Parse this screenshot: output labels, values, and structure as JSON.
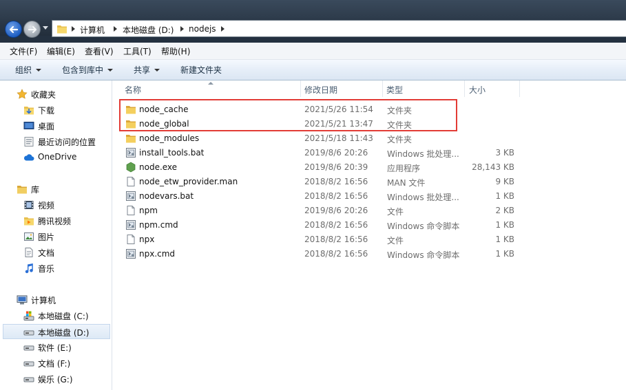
{
  "address": {
    "breadcrumbs": [
      "计算机",
      "本地磁盘 (D:)",
      "nodejs"
    ]
  },
  "menu": [
    "文件(F)",
    "编辑(E)",
    "查看(V)",
    "工具(T)",
    "帮助(H)"
  ],
  "toolbar": {
    "organize": "组织",
    "include_in_library": "包含到库中",
    "share": "共享",
    "new_folder": "新建文件夹"
  },
  "nav": {
    "favorites": {
      "label": "收藏夹",
      "items": [
        "下载",
        "桌面",
        "最近访问的位置",
        "OneDrive"
      ]
    },
    "libraries": {
      "label": "库",
      "items": [
        "视频",
        "腾讯视频",
        "图片",
        "文档",
        "音乐"
      ]
    },
    "computer": {
      "label": "计算机",
      "items": [
        "本地磁盘 (C:)",
        "本地磁盘 (D:)",
        "软件 (E:)",
        "文档 (F:)",
        "娱乐 (G:)"
      ]
    }
  },
  "columns": {
    "name": "名称",
    "date": "修改日期",
    "type": "类型",
    "size": "大小"
  },
  "files": [
    {
      "name": "node_cache",
      "date": "2021/5/26 11:54",
      "type": "文件夹",
      "size": "",
      "icon": "folder-icon"
    },
    {
      "name": "node_global",
      "date": "2021/5/21 13:47",
      "type": "文件夹",
      "size": "",
      "icon": "folder-icon"
    },
    {
      "name": "node_modules",
      "date": "2021/5/18 11:43",
      "type": "文件夹",
      "size": "",
      "icon": "folder-icon"
    },
    {
      "name": "install_tools.bat",
      "date": "2019/8/6 20:26",
      "type": "Windows 批处理...",
      "size": "3 KB",
      "icon": "batch-file-icon"
    },
    {
      "name": "node.exe",
      "date": "2019/8/6 20:39",
      "type": "应用程序",
      "size": "28,143 KB",
      "icon": "node-exe-icon"
    },
    {
      "name": "node_etw_provider.man",
      "date": "2018/8/2 16:56",
      "type": "MAN 文件",
      "size": "9 KB",
      "icon": "blank-file-icon"
    },
    {
      "name": "nodevars.bat",
      "date": "2018/8/2 16:56",
      "type": "Windows 批处理...",
      "size": "1 KB",
      "icon": "batch-file-icon"
    },
    {
      "name": "npm",
      "date": "2019/8/6 20:26",
      "type": "文件",
      "size": "2 KB",
      "icon": "blank-file-icon"
    },
    {
      "name": "npm.cmd",
      "date": "2018/8/2 16:56",
      "type": "Windows 命令脚本",
      "size": "1 KB",
      "icon": "batch-file-icon"
    },
    {
      "name": "npx",
      "date": "2018/8/2 16:56",
      "type": "文件",
      "size": "1 KB",
      "icon": "blank-file-icon"
    },
    {
      "name": "npx.cmd",
      "date": "2018/8/2 16:56",
      "type": "Windows 命令脚本",
      "size": "1 KB",
      "icon": "batch-file-icon"
    }
  ],
  "colors": {
    "highlight": "#e23b35",
    "accent": "#1f5fc2"
  }
}
